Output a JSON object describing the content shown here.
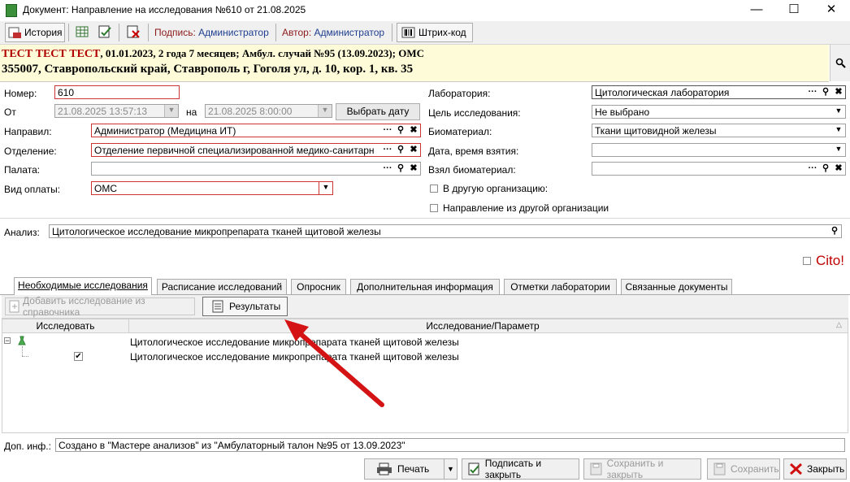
{
  "window": {
    "title": "Документ: Направление на исследования №610 от 21.08.2025"
  },
  "toolbar": {
    "history_label": "История",
    "sign_label": "Подпись:",
    "sign_value": "Администратор",
    "author_label": "Автор:",
    "author_value": "Администратор",
    "barcode_label": "Штрих-код"
  },
  "patient": {
    "name": "ТЕСТ ТЕСТ ТЕСТ",
    "info": ", 01.01.2023, 2 года 7 месяцев; Амбул. случай №95 (13.09.2023); ОМС",
    "address": "355007, Ставропольский край, Ставрополь г, Гоголя ул, д. 10, кор. 1, кв. 35"
  },
  "form": {
    "number_label": "Номер:",
    "number_value": "610",
    "from_label": "От",
    "from_value": "21.08.2025 13:57:13",
    "to_label": "на",
    "to_value": "21.08.2025 8:00:00",
    "choose_date_label": "Выбрать дату",
    "referred_label": "Направил:",
    "referred_value": "Администратор (Медицина ИТ)",
    "department_label": "Отделение:",
    "department_value": "Отделение первичной специализированной медико-санитарн",
    "ward_label": "Палата:",
    "ward_value": "",
    "payment_label": "Вид оплаты:",
    "payment_value": "ОМС",
    "lab_label": "Лаборатория:",
    "lab_value": "Цитологическая лаборатория",
    "goal_label": "Цель исследования:",
    "goal_value": "Не выбрано",
    "biomaterial_label": "Биоматериал:",
    "biomaterial_value": "Ткани щитовидной железы",
    "date_taken_label": "Дата, время взятия:",
    "date_taken_value": "",
    "taker_label": "Взял биоматериал:",
    "taker_value": "",
    "other_org_label": "В другую организацию:",
    "from_other_org_label": "Направление из другой организации",
    "analysis_label": "Анализ:",
    "analysis_value": "Цитологическое исследование микропрепарата тканей щитовой железы",
    "cito_label": "Cito!"
  },
  "tabs": [
    {
      "label": "Необходимые исследования"
    },
    {
      "label": "Расписание исследований"
    },
    {
      "label": "Опросник"
    },
    {
      "label": "Дополнительная информация"
    },
    {
      "label": "Отметки лаборатории"
    },
    {
      "label": "Связанные документы"
    }
  ],
  "subtoolbar": {
    "add_label": "Добавить исследование из справочника",
    "results_label": "Результаты"
  },
  "grid": {
    "col_research": "Исследовать",
    "col_param": "Исследование/Параметр",
    "rows": [
      {
        "text": "Цитологическое исследование микропрепарата тканей щитовой железы"
      },
      {
        "text": "Цитологическое исследование микропрепарата тканей щитовой железы"
      }
    ]
  },
  "footer": {
    "extra_label": "Доп. инф.:",
    "extra_value": "Создано в \"Мастере анализов\" из \"Амбулаторный талон №95 от 13.09.2023\"",
    "print_label": "Печать",
    "sign_close_label": "Подписать и закрыть",
    "save_close_label": "Сохранить и закрыть",
    "save_label": "Сохранить",
    "close_label": "Закрыть"
  },
  "colors": {
    "patient_bg": "#fdfbd8",
    "patient_name": "#b00000",
    "required_border": "#cc3333",
    "arrow": "#d41414",
    "cito": "#c00000"
  }
}
